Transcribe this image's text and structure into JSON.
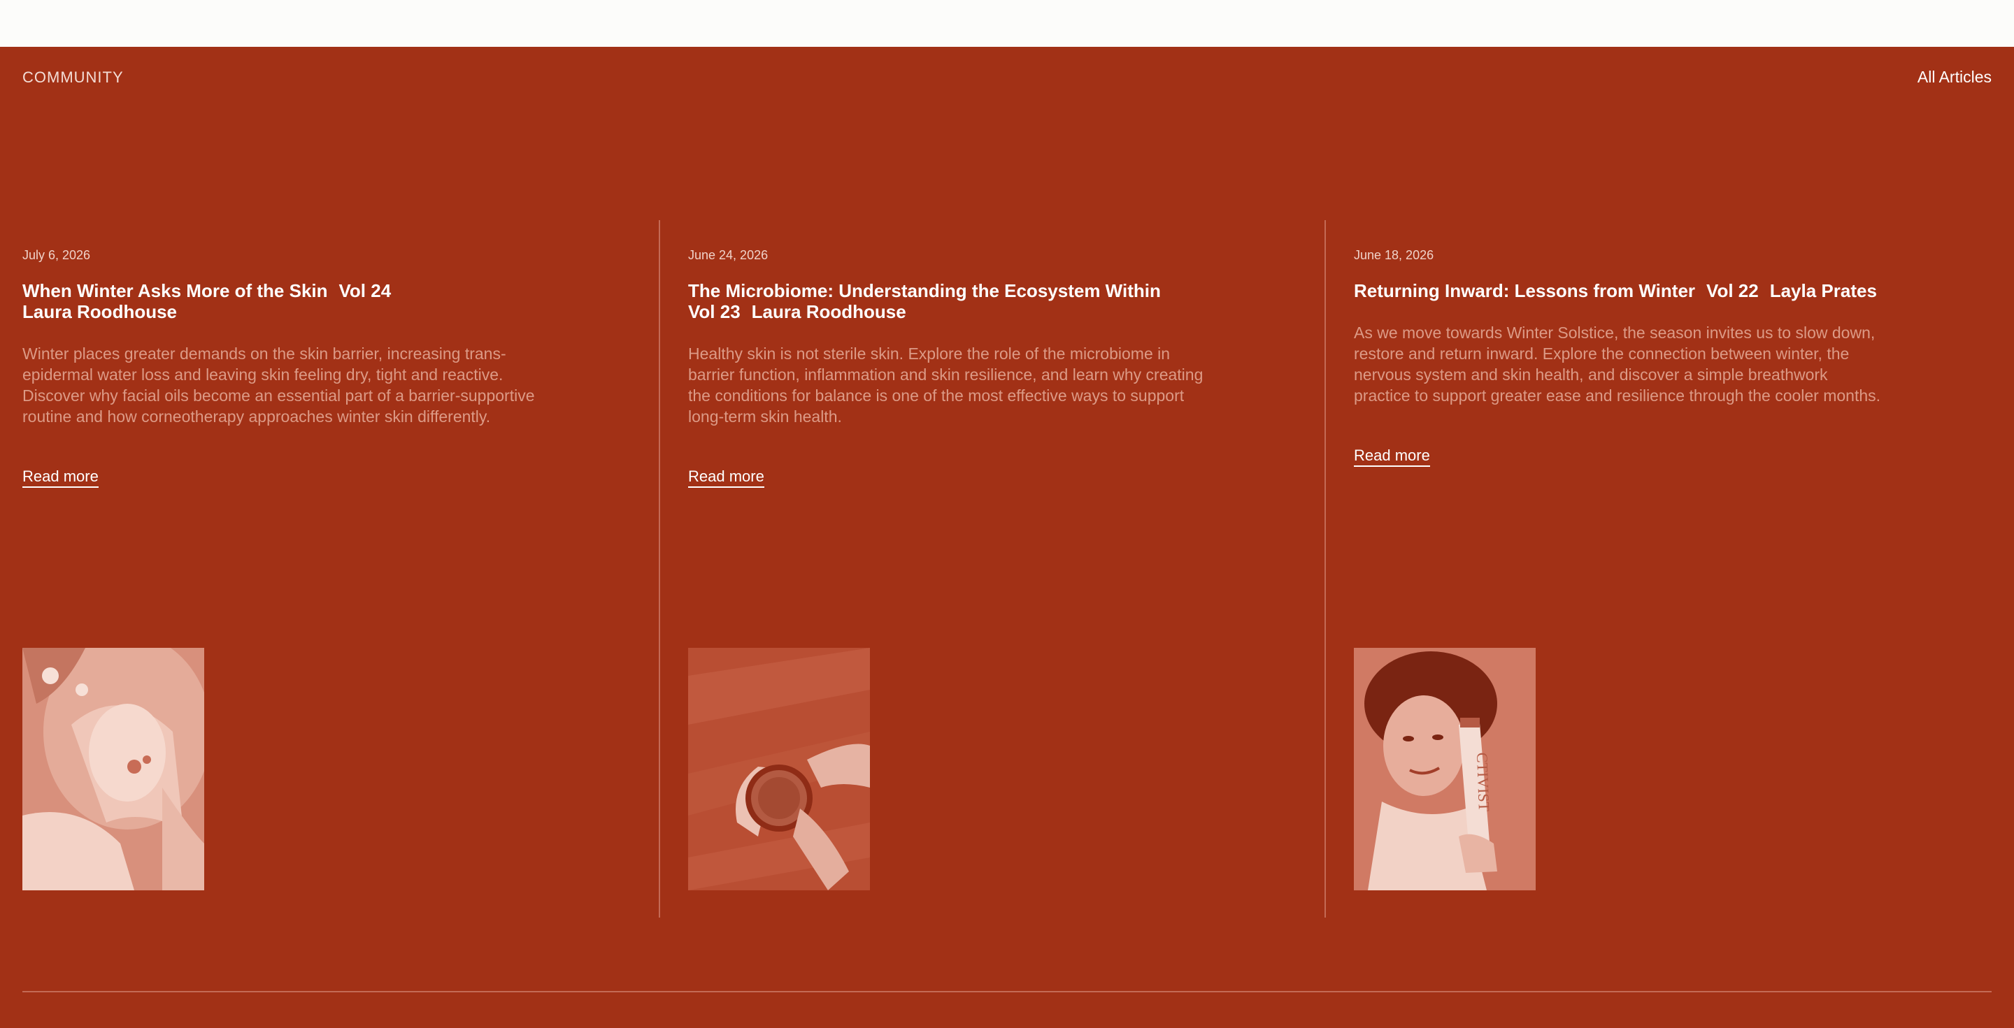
{
  "section": {
    "label": "COMMUNITY",
    "all_articles_label": "All Articles"
  },
  "articles": [
    {
      "date": "July 6, 2026",
      "title": "When Winter Asks More of the Skin",
      "volume": "Vol 24",
      "author": "Laura Roodhouse",
      "excerpt": "Winter places greater demands on the skin barrier, increasing trans-epidermal water loss and leaving skin feeling dry, tight and reactive. Discover why facial oils become an essential part of a barrier-supportive routine and how corneotherapy approaches winter skin differently.",
      "read_more": "Read more"
    },
    {
      "date": "June 24, 2026",
      "title": "The Microbiome: Understanding the Ecosystem Within",
      "volume": "Vol 23",
      "author": "Laura Roodhouse",
      "excerpt": "Healthy skin is not sterile skin. Explore the role of the microbiome in barrier function, inflammation and skin resilience, and learn why creating the conditions for balance is one of the most effective ways to support long-term skin health.",
      "read_more": "Read more"
    },
    {
      "date": "June 18, 2026",
      "title": "Returning Inward: Lessons from Winter",
      "volume": "Vol 22",
      "author": "Layla Prates",
      "excerpt": "As we move towards Winter Solstice, the season invites us to slow down, restore and return inward. Explore the connection between winter, the nervous system and skin health, and discover a simple breathwork practice to support greater ease and resilience through the cooler months.",
      "read_more": "Read more"
    }
  ],
  "images": {
    "product_text": "CTIVIST"
  },
  "colors": {
    "background": "#a23116",
    "divider": "#c36a55",
    "excerpt": "#dc9a86",
    "top_strip": "#fcfcfa"
  }
}
